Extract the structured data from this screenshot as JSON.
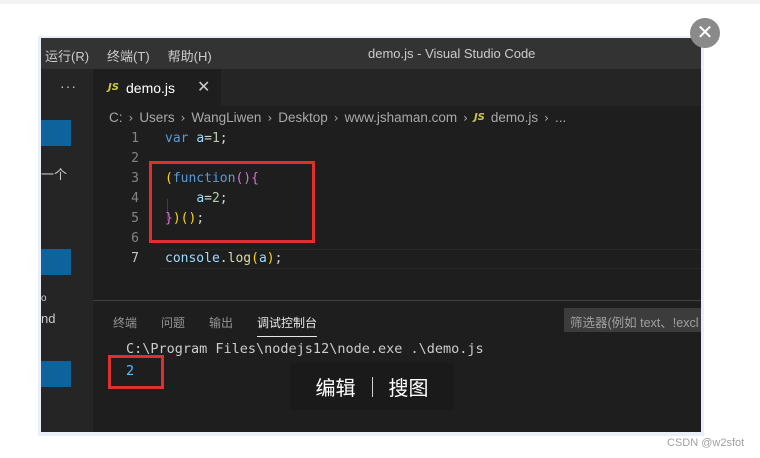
{
  "window": {
    "title": "demo.js - Visual Studio Code"
  },
  "menu": [
    "运行(R)",
    "终端(T)",
    "帮助(H)"
  ],
  "sidebar": {
    "more": "···",
    "texts": [
      "一个",
      "o",
      "nd"
    ]
  },
  "tab": {
    "label": "demo.js",
    "badge": "JS",
    "close": "✕"
  },
  "breadcrumb": [
    "C:",
    "Users",
    "WangLiwen",
    "Desktop",
    "www.jshaman.com",
    "demo.js",
    "..."
  ],
  "editor": {
    "line_numbers": [
      "1",
      "2",
      "3",
      "4",
      "5",
      "6",
      "7"
    ],
    "current_line": "7"
  },
  "panel": {
    "tabs": [
      "终端",
      "问题",
      "输出",
      "调试控制台"
    ],
    "active_tab": "调试控制台",
    "filter_placeholder": "筛选器(例如 text、!excl",
    "command": "C:\\Program Files\\nodejs12\\node.exe .\\demo.js",
    "output": "2"
  },
  "overlay": {
    "edit": "编辑",
    "search": "搜图"
  },
  "watermark": "CSDN @w2sfot",
  "colors": {
    "annotation": "#e02f2f",
    "editor_bg": "#1e1e1e",
    "accent": "#0e639c"
  }
}
